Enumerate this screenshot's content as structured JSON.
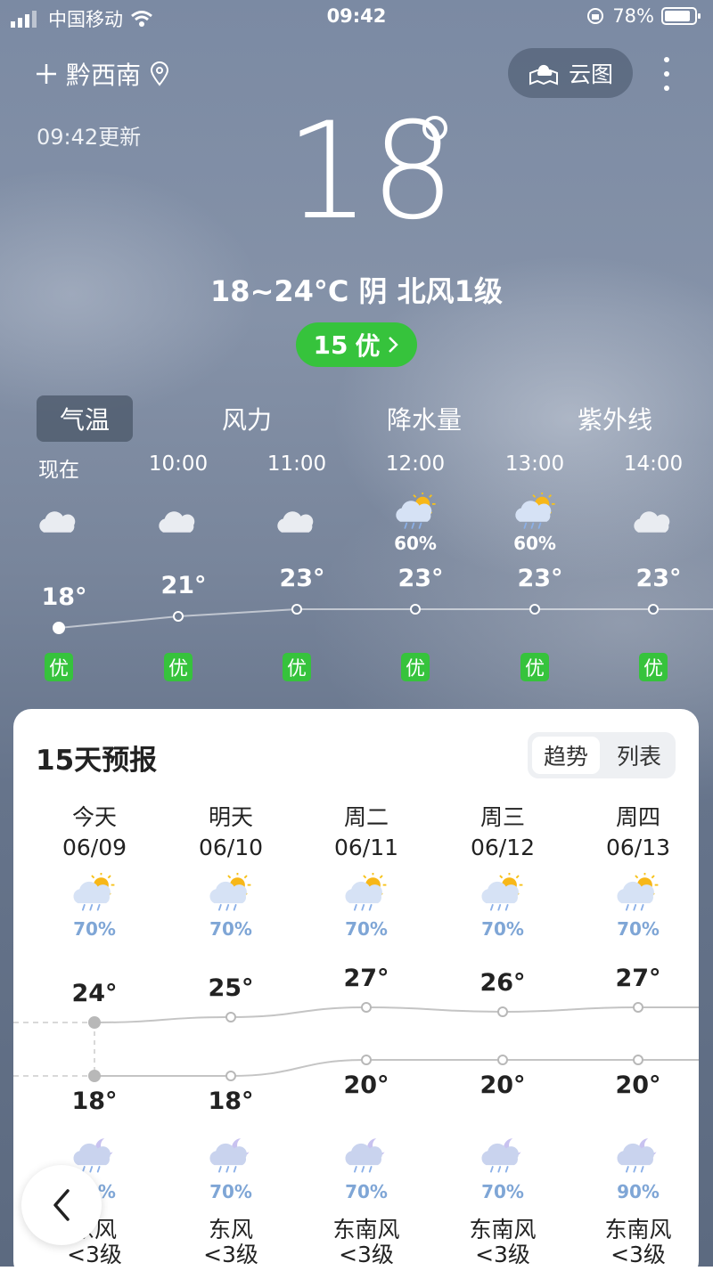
{
  "status_bar": {
    "carrier": "中国移动",
    "time": "09:42",
    "battery": "78%"
  },
  "header": {
    "city": "黔西南",
    "cloud_button": "云图",
    "updated": "09:42更新"
  },
  "current": {
    "temp": "18",
    "summary": "18~24°C 阴 北风1级",
    "aqi_value": "15",
    "aqi_label": "优"
  },
  "tabs": [
    {
      "label": "气温",
      "active": true
    },
    {
      "label": "风力",
      "active": false
    },
    {
      "label": "降水量",
      "active": false
    },
    {
      "label": "紫外线",
      "active": false
    }
  ],
  "hourly": [
    {
      "time": "现在",
      "icon": "cloudy-icon",
      "pop": "",
      "temp": "18°",
      "aq": "优"
    },
    {
      "time": "10:00",
      "icon": "cloudy-icon",
      "pop": "",
      "temp": "21°",
      "aq": "优"
    },
    {
      "time": "11:00",
      "icon": "cloudy-icon",
      "pop": "",
      "temp": "23°",
      "aq": "优"
    },
    {
      "time": "12:00",
      "icon": "sun-rain-icon",
      "pop": "60%",
      "temp": "23°",
      "aq": "优"
    },
    {
      "time": "13:00",
      "icon": "sun-rain-icon",
      "pop": "60%",
      "temp": "23°",
      "aq": "优"
    },
    {
      "time": "14:00",
      "icon": "cloudy-icon",
      "pop": "",
      "temp": "23°",
      "aq": "优"
    }
  ],
  "forecast": {
    "title": "15天预报",
    "view_options": [
      "趋势",
      "列表"
    ],
    "selected_view": "趋势",
    "days": [
      {
        "name": "今天",
        "date": "06/09",
        "day_pop": "70%",
        "high": "24°",
        "low": "18°",
        "night_pop": "70%",
        "wind": "东风",
        "level": "<3级"
      },
      {
        "name": "明天",
        "date": "06/10",
        "day_pop": "70%",
        "high": "25°",
        "low": "18°",
        "night_pop": "70%",
        "wind": "东风",
        "level": "<3级"
      },
      {
        "name": "周二",
        "date": "06/11",
        "day_pop": "70%",
        "high": "27°",
        "low": "20°",
        "night_pop": "70%",
        "wind": "东南风",
        "level": "<3级"
      },
      {
        "name": "周三",
        "date": "06/12",
        "day_pop": "70%",
        "high": "26°",
        "low": "20°",
        "night_pop": "70%",
        "wind": "东南风",
        "level": "<3级"
      },
      {
        "name": "周四",
        "date": "06/13",
        "day_pop": "70%",
        "high": "27°",
        "low": "20°",
        "night_pop": "90%",
        "wind": "东南风",
        "level": "<3级"
      }
    ]
  },
  "colors": {
    "aqi_green": "#36c33c",
    "pop_blue": "#7fa6d6"
  }
}
